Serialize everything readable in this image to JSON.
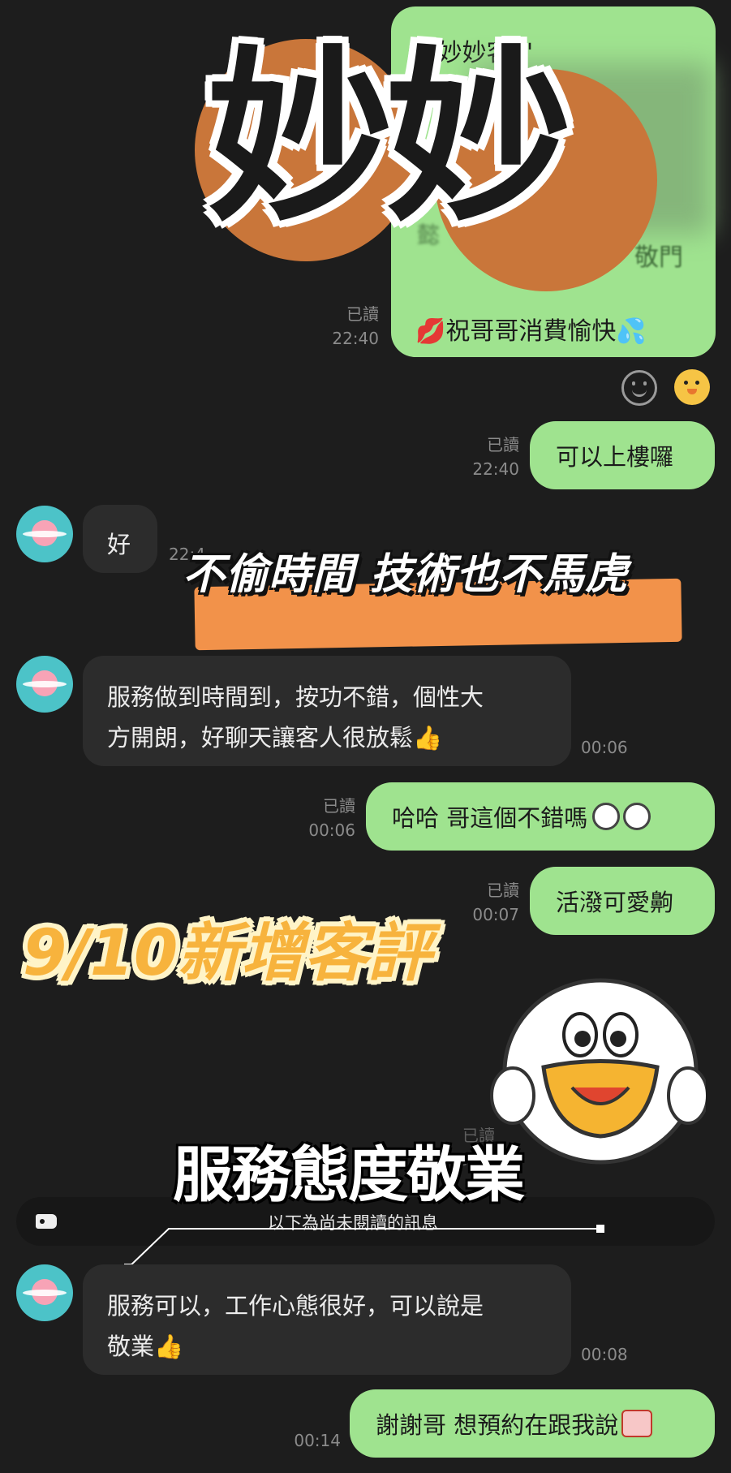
{
  "overlay": {
    "title_big": "妙妙",
    "banner_text": "不偷時間 技術也不馬虎",
    "date_title": "9/10新增客評",
    "stamp_text": "服務態度敬業"
  },
  "top_card": {
    "header": "\"\"妙妙客\"\"",
    "blurred_line_1": "請我",
    "blurred_line_2": "懿",
    "blurred_line_3": "敬門",
    "footer": "💋祝哥哥消費愉快💦"
  },
  "reaction_icons": [
    "smile-icon",
    "chick-sticker-icon"
  ],
  "messages": [
    {
      "side": "right",
      "read": "已讀",
      "time": "22:40"
    },
    {
      "side": "right",
      "text": "可以上樓囉",
      "read": "已讀",
      "time": "22:40"
    },
    {
      "side": "left",
      "text": "好",
      "time": "22:4"
    },
    {
      "side": "left",
      "text_line_1": "服務做到時間到，按功不錯，個性大",
      "text_line_2": "方開朗，好聊天讓客人很放鬆👍",
      "time": "00:06"
    },
    {
      "side": "right",
      "text": "哈哈 哥這個不錯嗎",
      "read": "已讀",
      "time": "00:06"
    },
    {
      "side": "right",
      "text": "活潑可愛齁",
      "read": "已讀",
      "time": "00:07"
    },
    {
      "side": "right",
      "read": "已讀",
      "time": "00:0"
    },
    {
      "side": "left",
      "text_line_1": "服務可以，工作心態很好，可以說是",
      "text_line_2": "敬業👍",
      "time": "00:08"
    },
    {
      "side": "right",
      "text": "謝謝哥 想預約在跟我說",
      "time": "00:14"
    }
  ],
  "unread_divider": {
    "label": "以下為尚未閱讀的訊息"
  },
  "colors": {
    "bubble_green": "#9fe38f",
    "bubble_dark": "#2c2c2c",
    "background": "#1d1d1d",
    "orange": "#f2924a",
    "circle_brown": "#c9763a"
  }
}
